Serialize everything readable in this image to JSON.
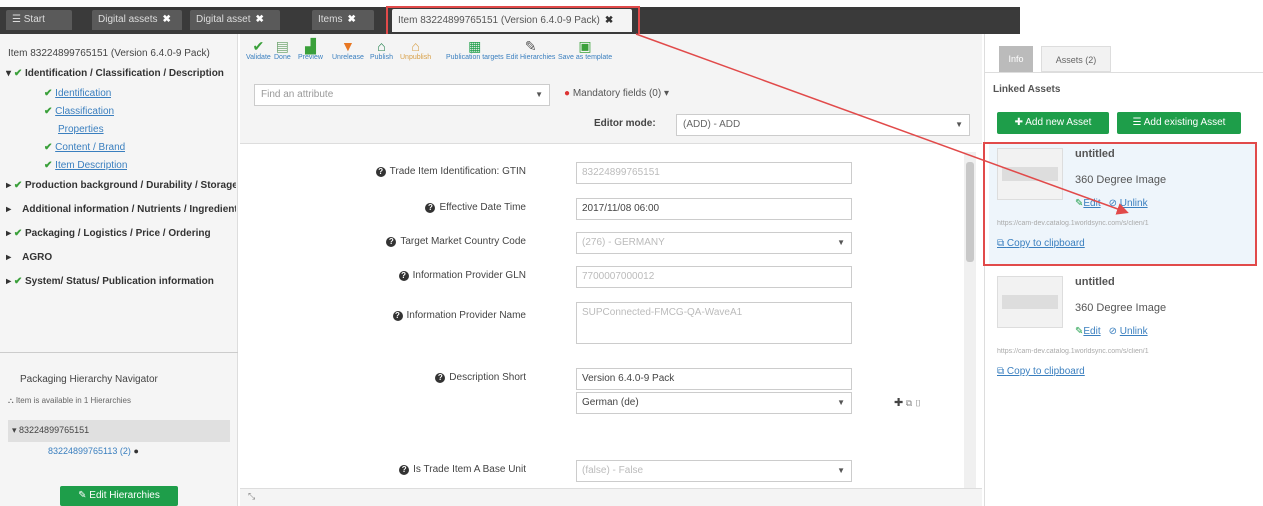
{
  "tabs": [
    {
      "label": "Start",
      "icon": "menu-icon"
    },
    {
      "label": "Digital assets"
    },
    {
      "label": "Digital asset"
    },
    {
      "label": "Items"
    },
    {
      "label": "Item 83224899765151 (Version 6.4.0-9 Pack)"
    }
  ],
  "left": {
    "title": "Item 83224899765151 (Version 6.4.0-9 Pack)",
    "tree": [
      {
        "label": "Identification / Classification / Description",
        "bold": true
      },
      {
        "label": "Identification",
        "link": true
      },
      {
        "label": "Classification",
        "link": true
      },
      {
        "label": "Properties",
        "link": true
      },
      {
        "label": "Content / Brand",
        "link": true
      },
      {
        "label": "Item Description",
        "link": true
      },
      {
        "label": "Production background / Durability / Storage",
        "bold": true
      },
      {
        "label": "Additional information / Nutrients / Ingredients",
        "bold": true
      },
      {
        "label": "Packaging / Logistics / Price / Ordering",
        "bold": true
      },
      {
        "label": "AGRO",
        "bold": true
      },
      {
        "label": "System/ Status/ Publication information",
        "bold": true
      }
    ],
    "hierarchy_title": "Packaging Hierarchy Navigator",
    "hierarchy_note": "Item is available in 1 Hierarchies",
    "hierarchy_root": "83224899765151",
    "hierarchy_child": "83224899765113 (2)",
    "edit_hierarchies": "Edit Hierarchies"
  },
  "toolbar": [
    {
      "label": "Validate",
      "icon": "check-icon",
      "color": "#3aa03a"
    },
    {
      "label": "Done",
      "icon": "clipboard-icon",
      "color": "#7a7"
    },
    {
      "label": "Preview",
      "icon": "chart-icon",
      "color": "#3aa03a"
    },
    {
      "label": "Unrelease",
      "icon": "thumbs-down-icon",
      "color": "#e87722"
    },
    {
      "label": "Publish",
      "icon": "home-icon",
      "color": "#1e7e4a"
    },
    {
      "label": "Unpublish",
      "icon": "home-x-icon",
      "color": "#d8a048"
    },
    {
      "label": "Publication targets",
      "icon": "building-icon",
      "color": "#1e9e4a"
    },
    {
      "label": "Edit Hierarchies",
      "icon": "pencil-icon",
      "color": "#555"
    },
    {
      "label": "Save as template",
      "icon": "save-icon",
      "color": "#3aa03a"
    }
  ],
  "filter": {
    "placeholder": "Find an attribute",
    "mandatory": "Mandatory fields (0)",
    "editor_mode_label": "Editor mode:",
    "editor_mode_value": "(ADD) - ADD"
  },
  "form": [
    {
      "label": "Trade Item Identification: GTIN",
      "value": "83224899765151",
      "type": "text"
    },
    {
      "label": "Effective Date Time",
      "value": "2017/11/08 06:00",
      "type": "text",
      "dark": true
    },
    {
      "label": "Target Market Country Code",
      "value": "(276) - GERMANY",
      "type": "select"
    },
    {
      "label": "Information Provider GLN",
      "value": "7700007000012",
      "type": "text"
    },
    {
      "label": "Information Provider Name",
      "value": "SUPConnected-FMCG-QA-WaveA1",
      "type": "textarea"
    },
    {
      "label": "Description Short",
      "value": "Version 6.4.0-9 Pack",
      "type": "text",
      "dark": true,
      "lang": "German (de)"
    },
    {
      "label": "Is Trade Item A Base Unit",
      "value": "(false) - False",
      "type": "select"
    }
  ],
  "right": {
    "tab_info": "Info",
    "tab_assets": "Assets (2)",
    "linked_title": "Linked Assets",
    "add_new": "Add new Asset",
    "add_existing": "Add existing Asset",
    "assets": [
      {
        "title": "untitled",
        "type": "360 Degree Image",
        "edit": "Edit",
        "unlink": "Unlink",
        "url": "https://cam-dev.catalog.1worldsync.com/s/clien/1",
        "copy": "Copy to clipboard"
      },
      {
        "title": "untitled",
        "type": "360 Degree Image",
        "edit": "Edit",
        "unlink": "Unlink",
        "url": "https://cam-dev.catalog.1worldsync.com/s/clien/1",
        "copy": "Copy to clipboard"
      }
    ]
  },
  "colors": {
    "accent": "#1e9e4a",
    "highlight": "#e14a4a",
    "link": "#3a7fbf"
  }
}
